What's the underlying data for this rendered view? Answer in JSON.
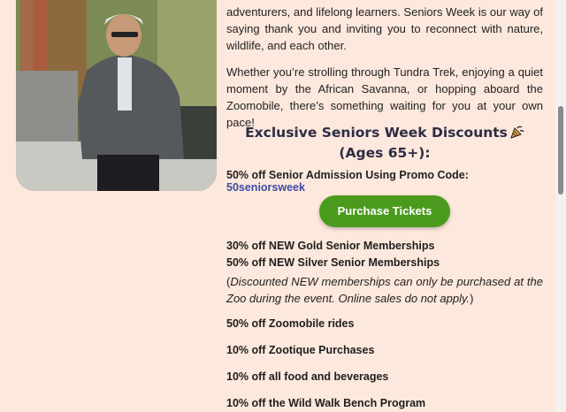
{
  "intro": {
    "paragraph1": "adventurers, and lifelong learners. Seniors Week is our way of saying thank you and inviting you to reconnect with nature, wildlife, and each other.",
    "paragraph2": "Whether you’re strolling through Tundra Trek, enjoying a quiet moment by the African Savanna, or hopping aboard the Zoomobile, there’s something waiting for you at your own pace!"
  },
  "discounts": {
    "heading_line1": "Exclusive Seniors Week Discounts",
    "heading_line2": "(Ages 65+):",
    "promo_label": "50% off Senior Admission Using Promo Code:",
    "promo_code": "50seniorsweek",
    "purchase_button": "Purchase Tickets",
    "gold_membership": "30% off NEW Gold Senior Memberships",
    "silver_membership": "50% off NEW Silver Senior Memberships",
    "membership_note_open": "(",
    "membership_note": "Discounted NEW memberships can only be purchased at the Zoo during the event. Online sales do not apply.",
    "membership_note_close": ")",
    "zoomobile": "50% off Zoomobile rides",
    "zootique": "10% off Zootique Purchases",
    "food": "10% off all food and beverages",
    "bench": "10% off the Wild Walk Bench Program"
  },
  "icons": {
    "heading_icon": "party-popper-icon"
  },
  "colors": {
    "background": "#fde8dd",
    "button": "#4a9b1d",
    "promo_code": "#3c4da6",
    "heading": "#2d2d44"
  }
}
